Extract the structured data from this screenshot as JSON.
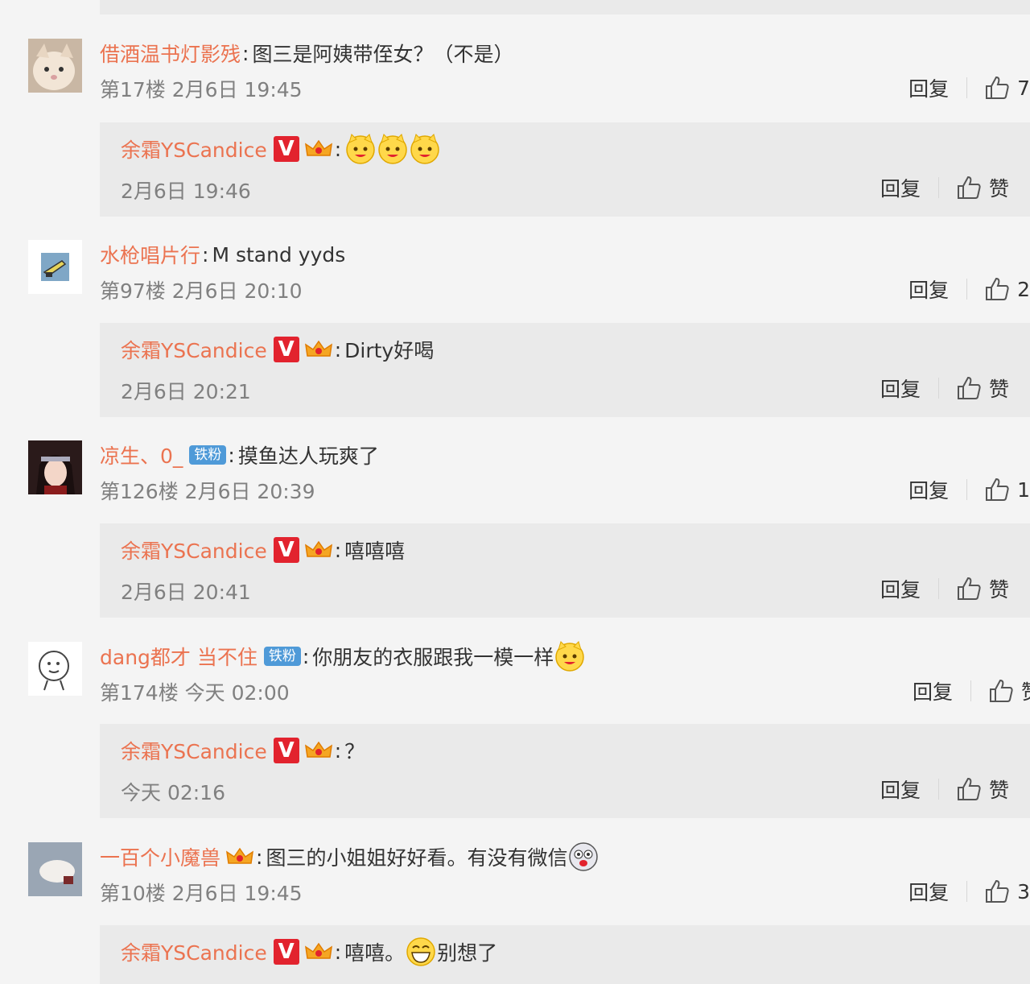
{
  "labels": {
    "reply": "回复",
    "like": "赞",
    "colon": ":"
  },
  "badges": {
    "verified": "V",
    "fan": "铁粉"
  },
  "colors": {
    "username": "#eb7350",
    "reply_bg": "#eaeaea",
    "page_bg": "#f4f4f4",
    "verified": "#e2232e",
    "fan_badge": "#4f9ad8"
  },
  "comments": [
    {
      "username": "借酒温书灯影残",
      "text": "图三是阿姨带侄女？（不是）",
      "meta": "第17楼 2月6日 19:45",
      "likes": "7",
      "reply": {
        "username": "余霜YSCandice",
        "text": "",
        "emoji_count": 3,
        "meta": "2月6日 19:46"
      }
    },
    {
      "username": "水枪唱片行",
      "text": "M stand yyds",
      "meta": "第97楼 2月6日 20:10",
      "likes": "2",
      "reply": {
        "username": "余霜YSCandice",
        "text": "Dirty好喝",
        "meta": "2月6日 20:21"
      }
    },
    {
      "username": "凉生、0_",
      "text": "摸鱼达人玩爽了",
      "meta": "第126楼 2月6日 20:39",
      "likes": "1",
      "reply": {
        "username": "余霜YSCandice",
        "text": "嘻嘻嘻",
        "meta": "2月6日 20:41"
      }
    },
    {
      "username": "dang都才 当不住",
      "text": "你朋友的衣服跟我一模一样",
      "meta": "第174楼 今天 02:00",
      "likes": "赞",
      "reply": {
        "username": "余霜YSCandice",
        "text": "？",
        "meta": "今天 02:16"
      }
    },
    {
      "username": "一百个小魔兽",
      "text": "图三的小姐姐好好看。有没有微信",
      "meta": "第10楼 2月6日 19:45",
      "likes": "3",
      "reply": {
        "username": "余霜YSCandice",
        "text": "嘻嘻。",
        "text2": "别想了",
        "meta": ""
      }
    }
  ]
}
